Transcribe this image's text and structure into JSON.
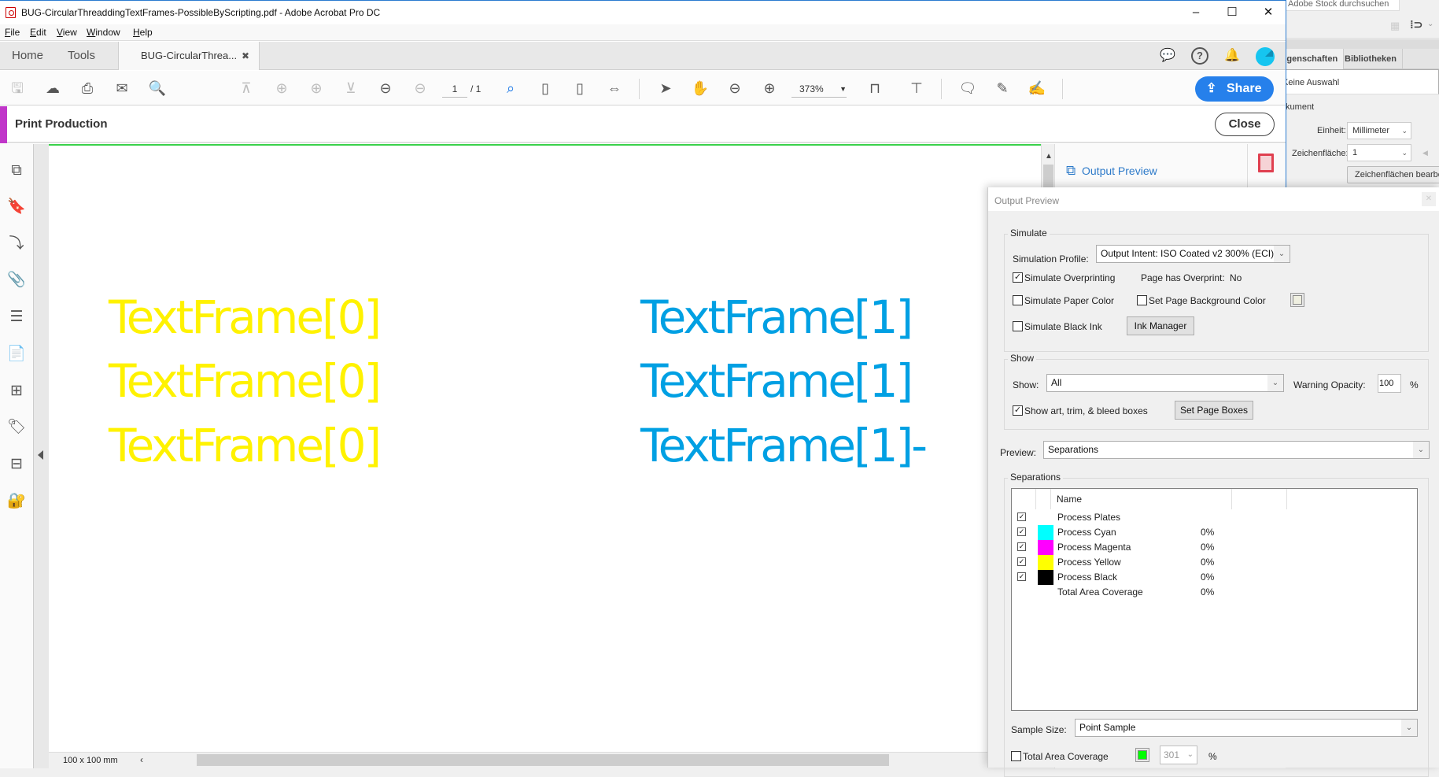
{
  "background_app": {
    "search_text": "Adobe Stock durchsuchen",
    "tabs": [
      "Eigenschaften",
      "Bibliotheken"
    ],
    "selection_label": "Keine Auswahl",
    "section_label": "Dokument",
    "unit_label": "Einheit:",
    "unit_value": "Millimeter",
    "artboard_label": "Zeichenfläche:",
    "artboard_value": "1",
    "edit_artboards_button": "Zeichenflächen bearbeiten"
  },
  "window": {
    "title": "BUG-CircularThreaddingTextFrames-PossibleByScripting.pdf - Adobe Acrobat Pro DC",
    "minimize": "–",
    "maximize": "☐",
    "close": "✕"
  },
  "menu": [
    "File",
    "Edit",
    "View",
    "Window",
    "Help"
  ],
  "tabs": {
    "home": "Home",
    "tools": "Tools",
    "document": "BUG-CircularThrea...",
    "close_glyph": "✖"
  },
  "toolbar": {
    "page_current": "1",
    "page_total": "/ 1",
    "zoom": "373%",
    "share_label": "Share"
  },
  "print_production": {
    "title": "Print Production",
    "close_label": "Close"
  },
  "document": {
    "yellow_frames": [
      "TextFrame[0]",
      "TextFrame[0]",
      "TextFrame[0]"
    ],
    "cyan_frames": [
      "TextFrame[1]",
      "TextFrame[1]",
      "TextFrame[1]-"
    ],
    "yellow_color": "#fff200",
    "cyan_color": "#00a0e3"
  },
  "status": {
    "page_size": "100 x 100 mm"
  },
  "right_panel": {
    "output_preview_label": "Output Preview"
  },
  "output_preview": {
    "title": "Output Preview",
    "simulate": {
      "group_label": "Simulate",
      "profile_label": "Simulation Profile:",
      "profile_value": "Output Intent: ISO Coated v2 300% (ECI)",
      "overprinting_label": "Simulate Overprinting",
      "overprinting_checked": true,
      "page_overprint_label": "Page has Overprint:",
      "page_overprint_value": "No",
      "paper_color_label": "Simulate Paper Color",
      "paper_color_checked": false,
      "bg_color_label": "Set Page Background Color",
      "bg_color_checked": false,
      "bg_color_swatch": "#efefe0",
      "black_ink_label": "Simulate Black Ink",
      "black_ink_checked": false,
      "ink_manager_button": "Ink Manager"
    },
    "show": {
      "group_label": "Show",
      "show_label": "Show:",
      "show_value": "All",
      "warning_opacity_label": "Warning Opacity:",
      "warning_opacity_value": "100",
      "percent": "%",
      "boxes_label": "Show art, trim, & bleed boxes",
      "boxes_checked": true,
      "set_page_boxes_button": "Set Page Boxes"
    },
    "preview_label": "Preview:",
    "preview_value": "Separations",
    "separations": {
      "group_label": "Separations",
      "header_name": "Name",
      "rows": [
        {
          "name": "Process Plates",
          "checked": true,
          "color": "",
          "coverage": ""
        },
        {
          "name": "Process Cyan",
          "checked": true,
          "color": "#00ffff",
          "coverage": "0%"
        },
        {
          "name": "Process Magenta",
          "checked": true,
          "color": "#ff00ff",
          "coverage": "0%"
        },
        {
          "name": "Process Yellow",
          "checked": true,
          "color": "#ffff00",
          "coverage": "0%"
        },
        {
          "name": "Process Black",
          "checked": true,
          "color": "#000000",
          "coverage": "0%"
        },
        {
          "name": "Total Area Coverage",
          "checked": false,
          "color": "",
          "coverage": "0%"
        }
      ]
    },
    "sample_size_label": "Sample Size:",
    "sample_size_value": "Point Sample",
    "tac_label": "Total Area Coverage",
    "tac_checked": false,
    "tac_color": "#00ff00",
    "tac_value": "301",
    "tac_percent": "%"
  }
}
